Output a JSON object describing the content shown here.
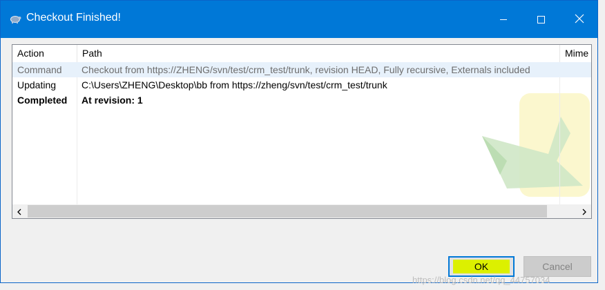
{
  "window": {
    "title": "Checkout Finished!"
  },
  "list": {
    "columns": [
      "Action",
      "Path",
      "Mime"
    ],
    "rows": [
      {
        "action": "Command",
        "path": "Checkout from https://ZHENG/svn/test/crm_test/trunk, revision HEAD, Fully recursive, Externals included",
        "style": "info"
      },
      {
        "action": "Updating",
        "path": "C:\\Users\\ZHENG\\Desktop\\bb from https://zheng/svn/test/crm_test/trunk",
        "style": "normal"
      },
      {
        "action": "Completed",
        "path": "At revision: 1",
        "style": "bold"
      }
    ]
  },
  "buttons": {
    "ok": "OK",
    "cancel": "Cancel"
  },
  "watermark_text": "https://blog.csdn.net/qq_44757034",
  "colors": {
    "titlebar": "#0078d7",
    "ok_highlight": "#dcf000",
    "info_row": "#e7f1fb"
  }
}
